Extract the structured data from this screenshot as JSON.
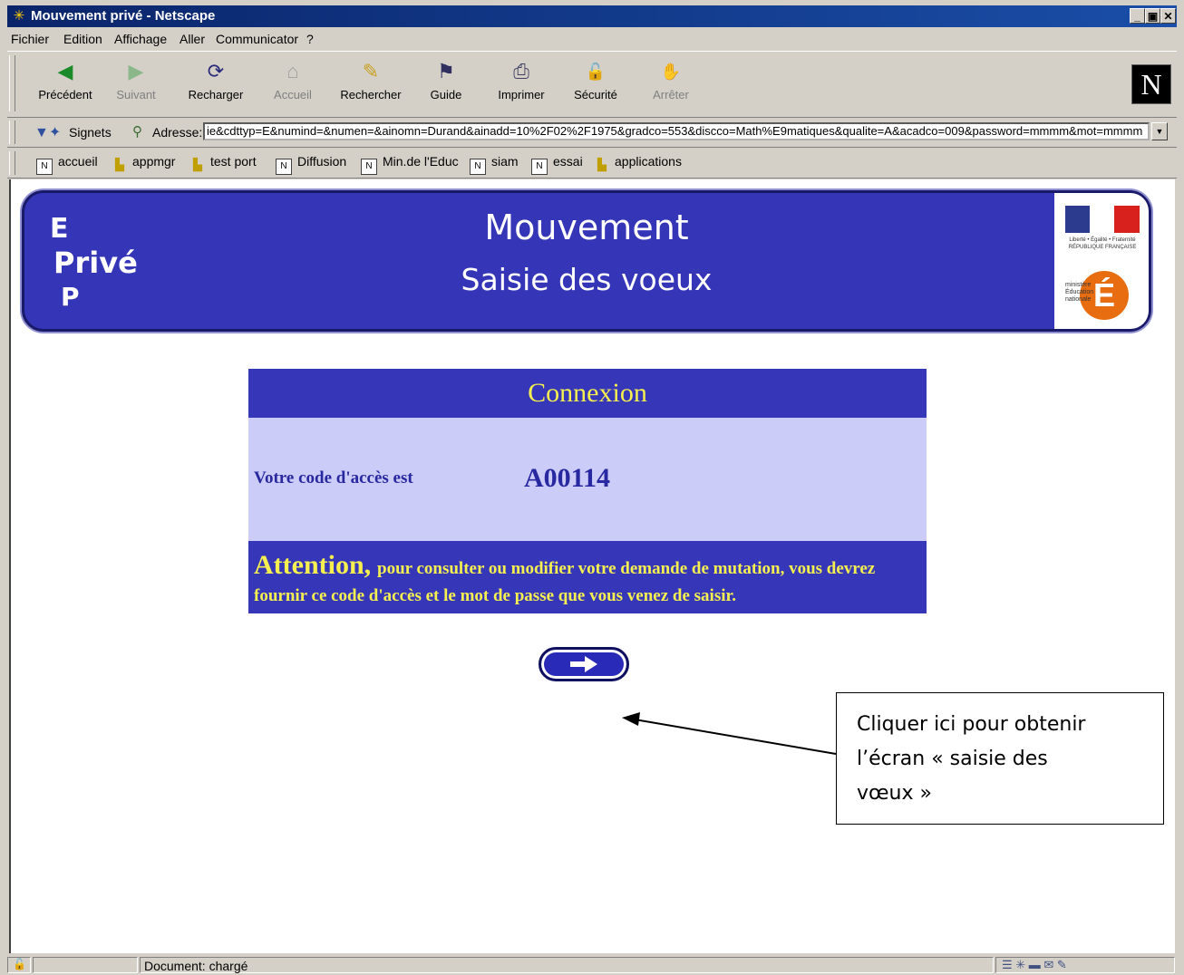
{
  "window": {
    "title": "Mouvement privé - Netscape",
    "min": "_",
    "max": "▣",
    "close": "✕"
  },
  "menu": {
    "items": [
      "Fichier",
      "Edition",
      "Affichage",
      "Aller",
      "Communicator",
      "?"
    ]
  },
  "toolbar": {
    "buttons": [
      {
        "label": "Précédent",
        "icon": "back-icon",
        "glyph": "◀"
      },
      {
        "label": "Suivant",
        "icon": "forward-icon",
        "glyph": "▶"
      },
      {
        "label": "Recharger",
        "icon": "reload-icon",
        "glyph": "⟳"
      },
      {
        "label": "Accueil",
        "icon": "home-icon",
        "glyph": "⌂"
      },
      {
        "label": "Rechercher",
        "icon": "search-icon",
        "glyph": "✎"
      },
      {
        "label": "Guide",
        "icon": "guide-icon",
        "glyph": "⚑"
      },
      {
        "label": "Imprimer",
        "icon": "print-icon",
        "glyph": "⎙"
      },
      {
        "label": "Sécurité",
        "icon": "lock-icon",
        "glyph": "🔓"
      },
      {
        "label": "Arrêter",
        "icon": "stop-icon",
        "glyph": "✋"
      }
    ],
    "logo_letter": "N"
  },
  "location": {
    "bookmarks_label": "Signets",
    "address_label": "Adresse:",
    "url": "ie&cdttyp=E&numind=&numen=&ainomn=Durand&ainadd=10%2F02%2F1975&gradco=553&discco=Math%E9matiques&qualite=A&acadco=009&password=mmmm&mot=mmmm"
  },
  "bookmarks": [
    {
      "label": "accueil",
      "icon": "page-icon"
    },
    {
      "label": "appmgr",
      "icon": "folder-icon"
    },
    {
      "label": "test port",
      "icon": "folder-icon"
    },
    {
      "label": "Diffusion",
      "icon": "page-icon"
    },
    {
      "label": "Min.de l'Educ",
      "icon": "page-icon"
    },
    {
      "label": "siam",
      "icon": "page-icon"
    },
    {
      "label": "essai",
      "icon": "page-icon"
    },
    {
      "label": "applications",
      "icon": "folder-icon"
    }
  ],
  "banner": {
    "left_e": "E",
    "left_prive": "Privé",
    "left_p": "P",
    "title": "Mouvement",
    "subtitle": "Saisie des voeux",
    "logo_republique": "Liberté • Égalité • Fraternité RÉPUBLIQUE FRANÇAISE",
    "logo_ministere": "ministère Éducation nationale",
    "logo_e": "É"
  },
  "connexion": {
    "header": "Connexion",
    "code_label": "Votre code d'accès est",
    "code_value": "A00114",
    "attention_word": "Attention,",
    "attention_line1": "pour consulter ou modifier votre demande de mutation, vous devrez",
    "attention_line2": "fournir ce code d'accès et le mot de passe que vous venez de saisir."
  },
  "callout": {
    "line1": "Cliquer ici pour obtenir",
    "line2": "l’écran « saisie des",
    "line3": "vœux »"
  },
  "status": {
    "text": "Document: chargé"
  }
}
